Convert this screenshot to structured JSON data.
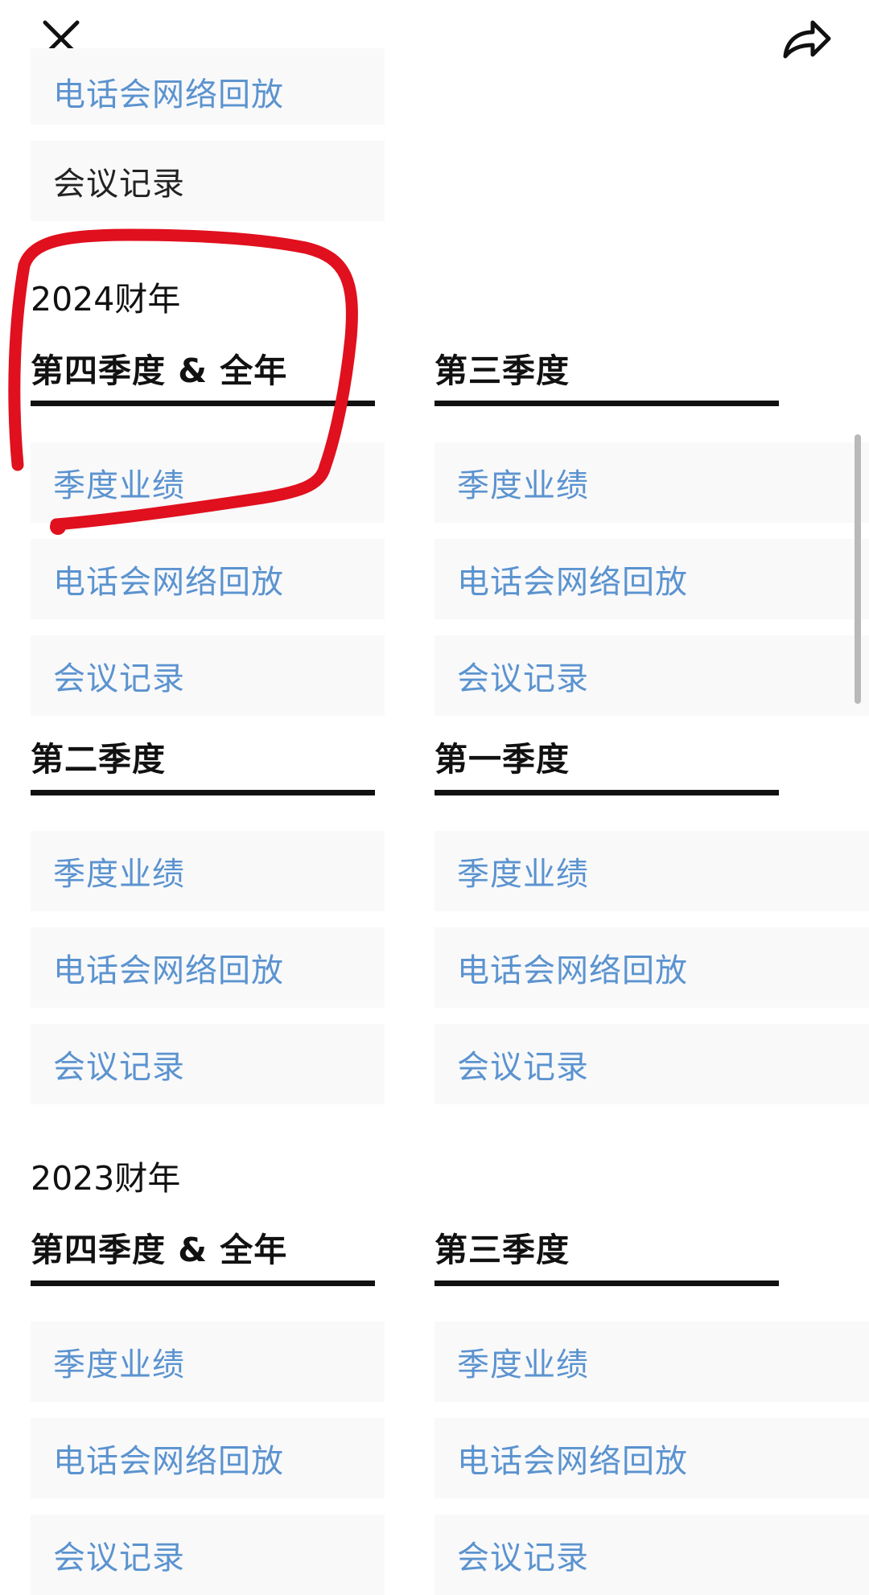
{
  "toolbar": {
    "close_icon": "close-icon",
    "share_icon": "share-icon"
  },
  "top_partial": {
    "webcast": "电话会网络回放",
    "minutes": "会议记录"
  },
  "fy2024": {
    "year_label": "2024财年",
    "q4": {
      "title": "第四季度 & 全年",
      "results": "季度业绩",
      "webcast": "电话会网络回放",
      "minutes": "会议记录"
    },
    "q3": {
      "title": "第三季度",
      "results": "季度业绩",
      "webcast": "电话会网络回放",
      "minutes": "会议记录"
    },
    "q2": {
      "title": "第二季度",
      "results": "季度业绩",
      "webcast": "电话会网络回放",
      "minutes": "会议记录"
    },
    "q1": {
      "title": "第一季度",
      "results": "季度业绩",
      "webcast": "电话会网络回放",
      "minutes": "会议记录"
    }
  },
  "fy2023": {
    "year_label": "2023财年",
    "q4": {
      "title": "第四季度 & 全年",
      "results": "季度业绩",
      "webcast": "电话会网络回放",
      "minutes": "会议记录"
    },
    "q3": {
      "title": "第三季度",
      "results": "季度业绩",
      "webcast": "电话会网络回放",
      "minutes": "会议记录"
    }
  },
  "colors": {
    "link": "#5b93cf",
    "annotation": "#e0101e",
    "row_bg": "#f9f9fa"
  }
}
